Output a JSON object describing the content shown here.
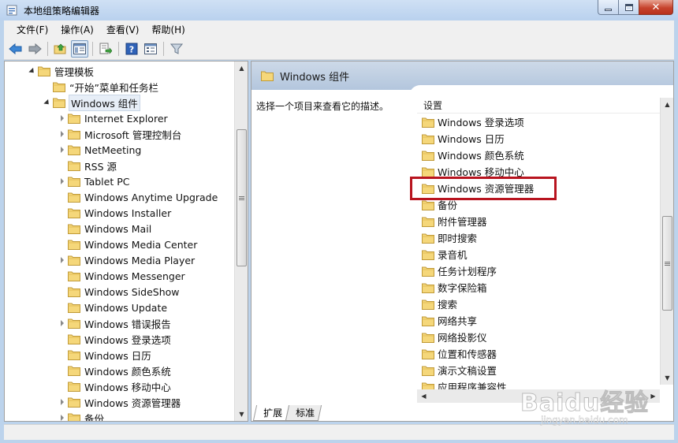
{
  "window": {
    "title": "本地组策略编辑器"
  },
  "menu": {
    "items": [
      "文件(F)",
      "操作(A)",
      "查看(V)",
      "帮助(H)"
    ]
  },
  "toolbar": {
    "icons": [
      "back-arrow-icon",
      "forward-arrow-icon",
      "up-folder-icon",
      "show-hide-tree-icon",
      "export-list-icon",
      "help-icon",
      "properties-icon",
      "filter-icon"
    ]
  },
  "tree": {
    "items": [
      {
        "label": "管理模板",
        "expander": "expanded",
        "level": 1
      },
      {
        "label": "“开始”菜单和任务栏",
        "expander": "none",
        "level": 2
      },
      {
        "label": "Windows 组件",
        "expander": "expanded",
        "level": 2,
        "selected": true
      },
      {
        "label": "Internet Explorer",
        "expander": "collapsed",
        "level": 3
      },
      {
        "label": "Microsoft 管理控制台",
        "expander": "collapsed",
        "level": 3
      },
      {
        "label": "NetMeeting",
        "expander": "collapsed",
        "level": 3
      },
      {
        "label": "RSS 源",
        "expander": "none",
        "level": 3
      },
      {
        "label": "Tablet PC",
        "expander": "collapsed",
        "level": 3
      },
      {
        "label": "Windows Anytime Upgrade",
        "expander": "none",
        "level": 3
      },
      {
        "label": "Windows Installer",
        "expander": "none",
        "level": 3
      },
      {
        "label": "Windows Mail",
        "expander": "none",
        "level": 3
      },
      {
        "label": "Windows Media Center",
        "expander": "none",
        "level": 3
      },
      {
        "label": "Windows Media Player",
        "expander": "collapsed",
        "level": 3
      },
      {
        "label": "Windows Messenger",
        "expander": "none",
        "level": 3
      },
      {
        "label": "Windows SideShow",
        "expander": "none",
        "level": 3
      },
      {
        "label": "Windows Update",
        "expander": "none",
        "level": 3
      },
      {
        "label": "Windows 错误报告",
        "expander": "collapsed",
        "level": 3
      },
      {
        "label": "Windows 登录选项",
        "expander": "none",
        "level": 3
      },
      {
        "label": "Windows 日历",
        "expander": "none",
        "level": 3
      },
      {
        "label": "Windows 颜色系统",
        "expander": "none",
        "level": 3
      },
      {
        "label": "Windows 移动中心",
        "expander": "none",
        "level": 3
      },
      {
        "label": "Windows 资源管理器",
        "expander": "collapsed",
        "level": 3
      },
      {
        "label": "备份",
        "expander": "collapsed",
        "level": 3
      }
    ]
  },
  "detail": {
    "header_title": "Windows 组件",
    "description": "选择一个项目来查看它的描述。",
    "column_header": "设置",
    "highlighted_item": "Windows 资源管理器",
    "items": [
      "Windows 登录选项",
      "Windows 日历",
      "Windows 颜色系统",
      "Windows 移动中心",
      "Windows 资源管理器",
      "备份",
      "附件管理器",
      "即时搜索",
      "录音机",
      "任务计划程序",
      "数字保险箱",
      "搜索",
      "网络共享",
      "网络投影仪",
      "位置和传感器",
      "演示文稿设置",
      "应用程序兼容性"
    ],
    "tabs": [
      "扩展",
      "标准"
    ],
    "active_tab": "扩展"
  },
  "watermark": {
    "brand": "Baidu经验",
    "url": "jingyan.baidu.com"
  },
  "colors": {
    "highlight_border": "#b8141f",
    "folder_fill": "#f5d77a",
    "header_bg": "#b3c6dd"
  }
}
